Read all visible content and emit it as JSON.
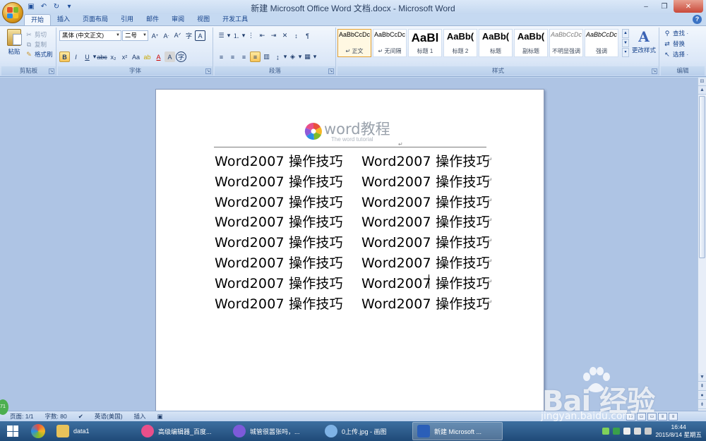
{
  "window": {
    "title": "新建 Microsoft Office Word 文档.docx - Microsoft Word",
    "minimize": "‒",
    "restore": "❐",
    "close": "✕"
  },
  "tabs": [
    {
      "label": "开始",
      "active": true
    },
    {
      "label": "插入"
    },
    {
      "label": "页面布局"
    },
    {
      "label": "引用"
    },
    {
      "label": "邮件"
    },
    {
      "label": "审阅"
    },
    {
      "label": "视图"
    },
    {
      "label": "开发工具"
    }
  ],
  "clipboard": {
    "group_label": "剪贴板",
    "paste": "粘贴",
    "cut": "剪切",
    "copy": "复制",
    "format_painter": "格式刷"
  },
  "font": {
    "group_label": "字体",
    "font_name": "黑体 (中文正文)",
    "font_size": "二号"
  },
  "paragraph": {
    "group_label": "段落"
  },
  "styles": {
    "group_label": "样式",
    "items": [
      {
        "sample": "AaBbCcDc",
        "name": "↵ 正文",
        "size": 9
      },
      {
        "sample": "AaBbCcDc",
        "name": "↵ 无间隔",
        "size": 9
      },
      {
        "sample": "AaBl",
        "name": "标题 1",
        "size": 17
      },
      {
        "sample": "AaBb(",
        "name": "标题 2",
        "size": 13
      },
      {
        "sample": "AaBb(",
        "name": "标题",
        "size": 13
      },
      {
        "sample": "AaBb(",
        "name": "副标题",
        "size": 13
      },
      {
        "sample": "AaBbCcDc",
        "name": "不明显强调",
        "size": 9
      },
      {
        "sample": "AaBbCcDc",
        "name": "强调",
        "size": 9
      }
    ],
    "change_styles": "更改样式"
  },
  "editing": {
    "group_label": "编辑",
    "find": "查找 ·",
    "replace": "替换",
    "select": "选择 ·"
  },
  "document": {
    "header_logo_text": "word教程",
    "header_logo_sub": "The word tutorial",
    "lines": [
      {
        "left": "Word2007 操作技巧",
        "right": "Word2007 操作技巧"
      },
      {
        "left": "Word2007 操作技巧",
        "right": "Word2007 操作技巧"
      },
      {
        "left": "Word2007 操作技巧",
        "right": "Word2007 操作技巧"
      },
      {
        "left": "Word2007 操作技巧",
        "right": "Word2007 操作技巧"
      },
      {
        "left": "Word2007 操作技巧",
        "right": "Word2007 操作技巧"
      },
      {
        "left": "Word2007 操作技巧",
        "right": "Word2007 操作技巧"
      },
      {
        "left": "Word2007 操作技巧",
        "right": "Word2007 操作技巧"
      },
      {
        "left": "Word2007 操作技巧",
        "right": "Word2007 操作技巧"
      }
    ],
    "paragraph_mark": "↵"
  },
  "statusbar": {
    "page": "页面: 1/1",
    "words": "字数: 80",
    "language": "英语(美国)",
    "mode": "插入",
    "badge": "71"
  },
  "taskbar": {
    "tasks": [
      {
        "label": "data1",
        "color": "#e8c25a"
      },
      {
        "label": "高级编辑器_百度...",
        "color": "#e94f8a"
      },
      {
        "label": "城管很嚣张吗，...",
        "color": "#7d5ad9"
      },
      {
        "label": "0上传.jpg - 画图",
        "color": "#7fb3e6"
      },
      {
        "label": "新建 Microsoft ...",
        "color": "#2b5fb8"
      }
    ],
    "time": "16:44",
    "date": "2015/8/14 星期五"
  },
  "watermark": {
    "brand": "Bai  经验",
    "url": "jingyan.baidu.com"
  }
}
